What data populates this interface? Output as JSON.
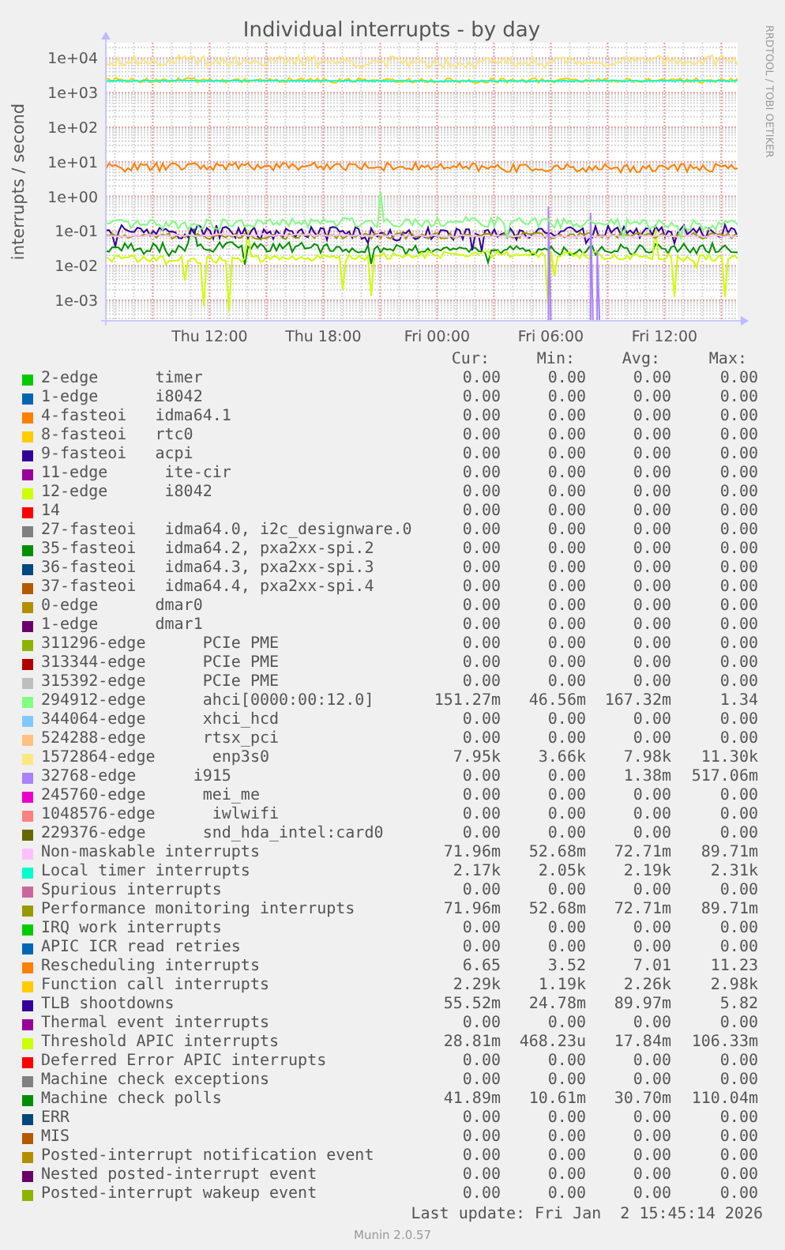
{
  "chart": {
    "title": "Individual interrupts - by day",
    "ylabel": "interrupts / second",
    "credit": "RRDTOOL / TOBI OETIKER",
    "yticks": [
      "1e+04",
      "1e+03",
      "1e+02",
      "1e+01",
      "1e+00",
      "1e-01",
      "1e-02",
      "1e-03"
    ],
    "xticks": [
      "Thu 12:00",
      "Thu 18:00",
      "Fri 00:00",
      "Fri 06:00",
      "Fri 12:00"
    ]
  },
  "legend": {
    "columns": [
      "Cur:",
      "Min:",
      "Avg:",
      "Max:"
    ],
    "rows": [
      {
        "label": "2-edge      timer",
        "color": "#00cc00",
        "cur": "0.00",
        "min": "0.00",
        "avg": "0.00",
        "max": "0.00"
      },
      {
        "label": "1-edge      i8042",
        "color": "#0066b3",
        "cur": "0.00",
        "min": "0.00",
        "avg": "0.00",
        "max": "0.00"
      },
      {
        "label": "4-fasteoi   idma64.1",
        "color": "#ff8000",
        "cur": "0.00",
        "min": "0.00",
        "avg": "0.00",
        "max": "0.00"
      },
      {
        "label": "8-fasteoi   rtc0",
        "color": "#ffcc00",
        "cur": "0.00",
        "min": "0.00",
        "avg": "0.00",
        "max": "0.00"
      },
      {
        "label": "9-fasteoi   acpi",
        "color": "#330099",
        "cur": "0.00",
        "min": "0.00",
        "avg": "0.00",
        "max": "0.00"
      },
      {
        "label": "11-edge      ite-cir",
        "color": "#990099",
        "cur": "0.00",
        "min": "0.00",
        "avg": "0.00",
        "max": "0.00"
      },
      {
        "label": "12-edge      i8042",
        "color": "#ccff00",
        "cur": "0.00",
        "min": "0.00",
        "avg": "0.00",
        "max": "0.00"
      },
      {
        "label": "14",
        "color": "#ff0000",
        "cur": "0.00",
        "min": "0.00",
        "avg": "0.00",
        "max": "0.00"
      },
      {
        "label": "27-fasteoi   idma64.0, i2c_designware.0",
        "color": "#808080",
        "cur": "0.00",
        "min": "0.00",
        "avg": "0.00",
        "max": "0.00"
      },
      {
        "label": "35-fasteoi   idma64.2, pxa2xx-spi.2",
        "color": "#008f00",
        "cur": "0.00",
        "min": "0.00",
        "avg": "0.00",
        "max": "0.00"
      },
      {
        "label": "36-fasteoi   idma64.3, pxa2xx-spi.3",
        "color": "#00487d",
        "cur": "0.00",
        "min": "0.00",
        "avg": "0.00",
        "max": "0.00"
      },
      {
        "label": "37-fasteoi   idma64.4, pxa2xx-spi.4",
        "color": "#b35a00",
        "cur": "0.00",
        "min": "0.00",
        "avg": "0.00",
        "max": "0.00"
      },
      {
        "label": "0-edge      dmar0",
        "color": "#b38f00",
        "cur": "0.00",
        "min": "0.00",
        "avg": "0.00",
        "max": "0.00"
      },
      {
        "label": "1-edge      dmar1",
        "color": "#6b006b",
        "cur": "0.00",
        "min": "0.00",
        "avg": "0.00",
        "max": "0.00"
      },
      {
        "label": "311296-edge      PCIe PME",
        "color": "#8fb300",
        "cur": "0.00",
        "min": "0.00",
        "avg": "0.00",
        "max": "0.00"
      },
      {
        "label": "313344-edge      PCIe PME",
        "color": "#b30000",
        "cur": "0.00",
        "min": "0.00",
        "avg": "0.00",
        "max": "0.00"
      },
      {
        "label": "315392-edge      PCIe PME",
        "color": "#bebebe",
        "cur": "0.00",
        "min": "0.00",
        "avg": "0.00",
        "max": "0.00"
      },
      {
        "label": "294912-edge      ahci[0000:00:12.0]",
        "color": "#80ff80",
        "cur": "151.27m",
        "min": "46.56m",
        "avg": "167.32m",
        "max": "1.34"
      },
      {
        "label": "344064-edge      xhci_hcd",
        "color": "#80c9ff",
        "cur": "0.00",
        "min": "0.00",
        "avg": "0.00",
        "max": "0.00"
      },
      {
        "label": "524288-edge      rtsx_pci",
        "color": "#ffc080",
        "cur": "0.00",
        "min": "0.00",
        "avg": "0.00",
        "max": "0.00"
      },
      {
        "label": "1572864-edge      enp3s0",
        "color": "#ffe680",
        "cur": "7.95k",
        "min": "3.66k",
        "avg": "7.98k",
        "max": "11.30k"
      },
      {
        "label": "32768-edge      i915",
        "color": "#aa80ff",
        "cur": "0.00",
        "min": "0.00",
        "avg": "1.38m",
        "max": "517.06m"
      },
      {
        "label": "245760-edge      mei_me",
        "color": "#ee00cc",
        "cur": "0.00",
        "min": "0.00",
        "avg": "0.00",
        "max": "0.00"
      },
      {
        "label": "1048576-edge      iwlwifi",
        "color": "#ff8080",
        "cur": "0.00",
        "min": "0.00",
        "avg": "0.00",
        "max": "0.00"
      },
      {
        "label": "229376-edge      snd_hda_intel:card0",
        "color": "#666600",
        "cur": "0.00",
        "min": "0.00",
        "avg": "0.00",
        "max": "0.00"
      },
      {
        "label": "Non-maskable interrupts",
        "color": "#ffbfff",
        "cur": "71.96m",
        "min": "52.68m",
        "avg": "72.71m",
        "max": "89.71m"
      },
      {
        "label": "Local timer interrupts",
        "color": "#00ffcc",
        "cur": "2.17k",
        "min": "2.05k",
        "avg": "2.19k",
        "max": "2.31k"
      },
      {
        "label": "Spurious interrupts",
        "color": "#cc6699",
        "cur": "0.00",
        "min": "0.00",
        "avg": "0.00",
        "max": "0.00"
      },
      {
        "label": "Performance monitoring interrupts",
        "color": "#999900",
        "cur": "71.96m",
        "min": "52.68m",
        "avg": "72.71m",
        "max": "89.71m"
      },
      {
        "label": "IRQ work interrupts",
        "color": "#00cc00",
        "cur": "0.00",
        "min": "0.00",
        "avg": "0.00",
        "max": "0.00"
      },
      {
        "label": "APIC ICR read retries",
        "color": "#0066b3",
        "cur": "0.00",
        "min": "0.00",
        "avg": "0.00",
        "max": "0.00"
      },
      {
        "label": "Rescheduling interrupts",
        "color": "#ff8000",
        "cur": "6.65",
        "min": "3.52",
        "avg": "7.01",
        "max": "11.23"
      },
      {
        "label": "Function call interrupts",
        "color": "#ffcc00",
        "cur": "2.29k",
        "min": "1.19k",
        "avg": "2.26k",
        "max": "2.98k"
      },
      {
        "label": "TLB shootdowns",
        "color": "#330099",
        "cur": "55.52m",
        "min": "24.78m",
        "avg": "89.97m",
        "max": "5.82"
      },
      {
        "label": "Thermal event interrupts",
        "color": "#990099",
        "cur": "0.00",
        "min": "0.00",
        "avg": "0.00",
        "max": "0.00"
      },
      {
        "label": "Threshold APIC interrupts",
        "color": "#ccff00",
        "cur": "28.81m",
        "min": "468.23u",
        "avg": "17.84m",
        "max": "106.33m"
      },
      {
        "label": "Deferred Error APIC interrupts",
        "color": "#ff0000",
        "cur": "0.00",
        "min": "0.00",
        "avg": "0.00",
        "max": "0.00"
      },
      {
        "label": "Machine check exceptions",
        "color": "#808080",
        "cur": "0.00",
        "min": "0.00",
        "avg": "0.00",
        "max": "0.00"
      },
      {
        "label": "Machine check polls",
        "color": "#008f00",
        "cur": "41.89m",
        "min": "10.61m",
        "avg": "30.70m",
        "max": "110.04m"
      },
      {
        "label": "ERR",
        "color": "#00487d",
        "cur": "0.00",
        "min": "0.00",
        "avg": "0.00",
        "max": "0.00"
      },
      {
        "label": "MIS",
        "color": "#b35a00",
        "cur": "0.00",
        "min": "0.00",
        "avg": "0.00",
        "max": "0.00"
      },
      {
        "label": "Posted-interrupt notification event",
        "color": "#b38f00",
        "cur": "0.00",
        "min": "0.00",
        "avg": "0.00",
        "max": "0.00"
      },
      {
        "label": "Nested posted-interrupt event",
        "color": "#6b006b",
        "cur": "0.00",
        "min": "0.00",
        "avg": "0.00",
        "max": "0.00"
      },
      {
        "label": "Posted-interrupt wakeup event",
        "color": "#8fb300",
        "cur": "0.00",
        "min": "0.00",
        "avg": "0.00",
        "max": "0.00"
      }
    ]
  },
  "last_update": "Last update: Fri Jan  2 15:45:14 2026",
  "footer": "Munin 2.0.57"
}
